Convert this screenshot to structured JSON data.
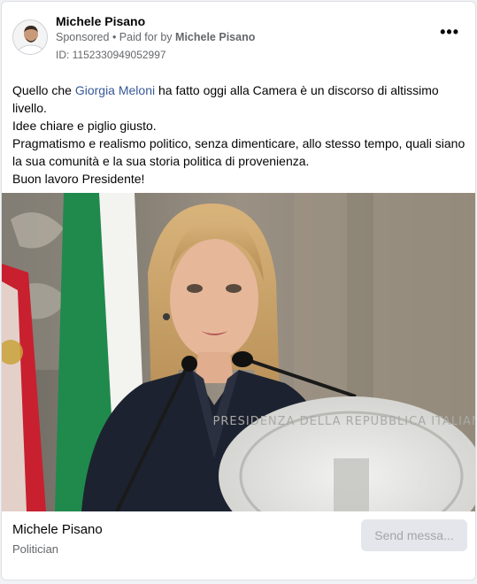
{
  "post": {
    "author": "Michele Pisano",
    "sponsored": "Sponsored",
    "separator": " • ",
    "paid_for_prefix": "Paid for by ",
    "paid_for_name": "Michele Pisano",
    "ad_id": "ID: 1152330949052997",
    "more_icon": "more-options-icon",
    "avatar_icon": "profile-photo"
  },
  "body": {
    "line1_prefix": "Quello che ",
    "line1_mention": "Giorgia Meloni",
    "line1_suffix": " ha fatto oggi alla Camera è un discorso di altissimo livello.",
    "line2": "Idee chiare e piglio giusto.",
    "line3": "Pragmatismo e realismo politico, senza dimenticare, allo stesso tempo, quali siano la sua comunità e la sua storia politica di provenienza.",
    "line4": "Buon lavoro Presidente!"
  },
  "media": {
    "seal_text": "PRESIDENZA DELLA REPUBBLICA ITALIANA"
  },
  "footer": {
    "page_name": "Michele Pisano",
    "category": "Politician",
    "cta_label": "Send messa..."
  },
  "colors": {
    "mention": "#385898",
    "secondary_text": "#65676b",
    "cta_bg": "#e4e6eb",
    "cta_text": "#a2a5ab"
  }
}
